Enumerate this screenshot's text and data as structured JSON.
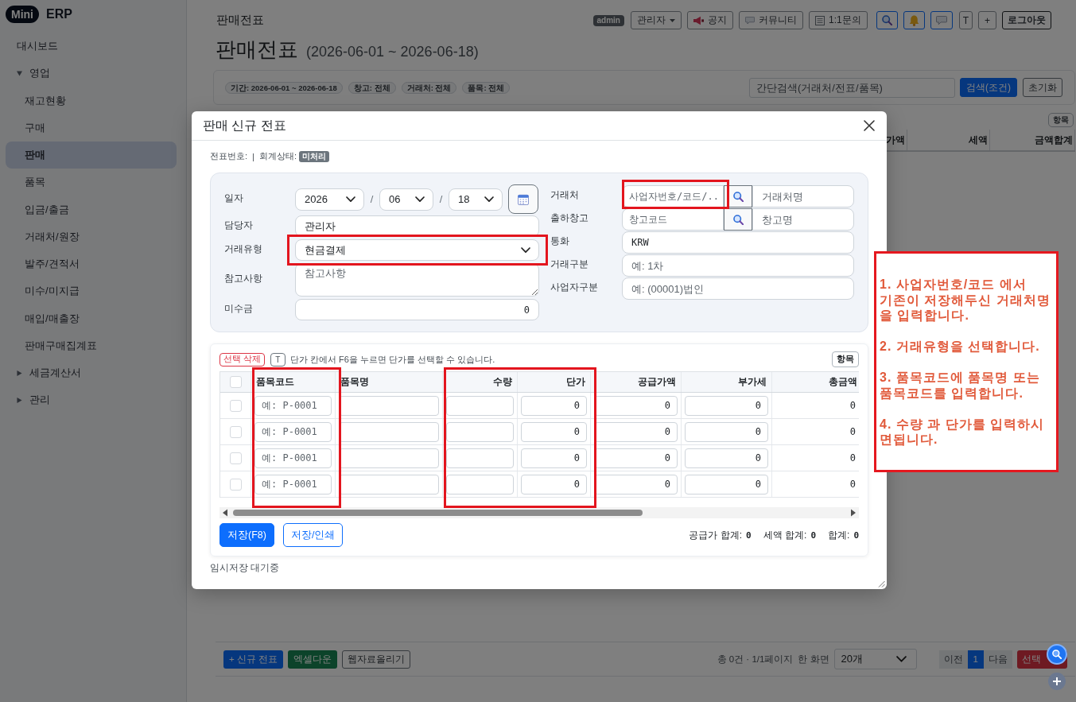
{
  "sidebar": {
    "logo_badge": "Mini",
    "logo_text": "ERP",
    "items": [
      {
        "kind": "link",
        "label": "대시보드",
        "selected": false
      },
      {
        "kind": "group",
        "label": "영업",
        "expanded": true,
        "selected": false,
        "children": [
          {
            "label": "재고현황",
            "selected": false
          },
          {
            "label": "구매",
            "selected": false
          },
          {
            "label": "판매",
            "selected": true
          },
          {
            "label": "품목",
            "selected": false
          },
          {
            "label": "입금/출금",
            "selected": false
          },
          {
            "label": "거래처/원장",
            "selected": false
          },
          {
            "label": "발주/견적서",
            "selected": false
          },
          {
            "label": "미수/미지급",
            "selected": false
          },
          {
            "label": "매입/매출장",
            "selected": false
          },
          {
            "label": "판매구매집계표",
            "selected": false
          }
        ]
      },
      {
        "kind": "group",
        "label": "세금계산서",
        "expanded": false,
        "selected": false
      },
      {
        "kind": "group",
        "label": "관리",
        "expanded": false,
        "selected": false
      }
    ]
  },
  "header": {
    "breadcrumb": "판매전표",
    "user_badge": "admin",
    "user_menu": "관리자",
    "notice_link": "공지",
    "community_link": "커뮤니티",
    "inquiry_link": "1:1문의",
    "text_buttons": [
      "T",
      "+"
    ],
    "logout_button": "로그아웃"
  },
  "page": {
    "title": "판매전표",
    "period": "(2026-06-01 ~ 2026-06-18)",
    "filter_chips": [
      "기간: 2026-06-01 ~ 2026-06-18",
      "창고: 전체",
      "거래처: 전체",
      "품목: 전체"
    ],
    "search": {
      "placeholder": "간단검색(거래처/전표/품목)"
    },
    "search_button": "검색(조건)",
    "reset_button": "초기화",
    "list_columns_button": "항목",
    "list_columns": [
      "가액",
      "세액",
      "금액합계"
    ]
  },
  "footer": {
    "new_button": "+ 신규 전표",
    "excel_button": "엑셀다운",
    "upload_button": "웹자료올리기",
    "summary": "총 0건 · 1/1페이지",
    "page_size_label": "한 화면",
    "page_size": "20개",
    "prev_button": "이전",
    "pages": [
      {
        "label": "1",
        "selected": true
      }
    ],
    "next_button": "다음",
    "delete_button": "선택"
  },
  "modal": {
    "title": "판매 신규 전표",
    "voucher_label": "전표번호:",
    "separator": "|",
    "status_label": "회계상태:",
    "status_badge": "미처리",
    "form": {
      "left": [
        {
          "kind": "date",
          "label": "일자",
          "parts": [
            "2026",
            "06",
            "18"
          ],
          "separators": [
            "/",
            "/"
          ],
          "highlighted": false
        },
        {
          "kind": "text",
          "label": "담당자",
          "value": "관리자",
          "highlighted": false
        },
        {
          "kind": "select",
          "label": "거래유형",
          "value": "현금결제",
          "highlighted": true
        },
        {
          "kind": "textarea",
          "label": "참고사항",
          "placeholder": "참고사항",
          "highlighted": false
        },
        {
          "kind": "number",
          "label": "미수금",
          "value": "0",
          "highlighted": false
        }
      ],
      "right": [
        {
          "kind": "lookup",
          "label": "거래처",
          "code_placeholder": "사업자번호/코드/..",
          "name_placeholder": "거래처명",
          "highlighted": true
        },
        {
          "kind": "lookup",
          "label": "출하창고",
          "code_placeholder": "창고코드",
          "name_placeholder": "창고명",
          "highlighted": false
        },
        {
          "kind": "code",
          "label": "통화",
          "value": "KRW",
          "highlighted": false
        },
        {
          "kind": "text",
          "label": "거래구분",
          "placeholder": "예: 1차",
          "highlighted": false
        },
        {
          "kind": "text",
          "label": "사업자구분",
          "placeholder": "예: (00001)법인",
          "highlighted": false
        }
      ]
    },
    "items": {
      "delete_button": "선택 삭제",
      "shortcut_key": "T",
      "hint": "단가 칸에서 F6을 누르면 단가를 선택할 수 있습니다.",
      "columns_button": "항목",
      "all_checked": false,
      "columns": [
        {
          "label": "품목코드",
          "highlighted": true
        },
        {
          "label": "품목명",
          "highlighted": false
        },
        {
          "label": "수량",
          "highlighted": true
        },
        {
          "label": "단가",
          "highlighted": true
        },
        {
          "label": "공급가액",
          "highlighted": false
        },
        {
          "label": "부가세",
          "highlighted": false
        },
        {
          "label": "총금액",
          "highlighted": false
        }
      ],
      "rows": [
        {
          "checked": false,
          "code_placeholder": "예: P-0001",
          "price": "0",
          "supply": "0",
          "vat": "0",
          "total": "0"
        },
        {
          "checked": false,
          "code_placeholder": "예: P-0001",
          "price": "0",
          "supply": "0",
          "vat": "0",
          "total": "0"
        },
        {
          "checked": false,
          "code_placeholder": "예: P-0001",
          "price": "0",
          "supply": "0",
          "vat": "0",
          "total": "0"
        },
        {
          "checked": false,
          "code_placeholder": "예: P-0001",
          "price": "0",
          "supply": "0",
          "vat": "0",
          "total": "0"
        }
      ],
      "save_button": "저장(F8)",
      "save_print_button": "저장/인쇄",
      "totals": [
        {
          "label": "공급가 합계:",
          "value": "0"
        },
        {
          "label": "세액 합계:",
          "value": "0"
        },
        {
          "label": "합계:",
          "value": "0"
        }
      ]
    },
    "autosave_status": "임시저장 대기중"
  },
  "guide": {
    "steps": [
      "1. 사업자번호/코드 에서\n기존이 저장해두신 거래처명을 입력합니다.",
      "2. 거래유형을 선택합니다.",
      "3. 품목코드에 품목명 또는 품목코드를 입력합니다.",
      "4. 수량 과 단가를 입력하시면됩니다."
    ]
  }
}
